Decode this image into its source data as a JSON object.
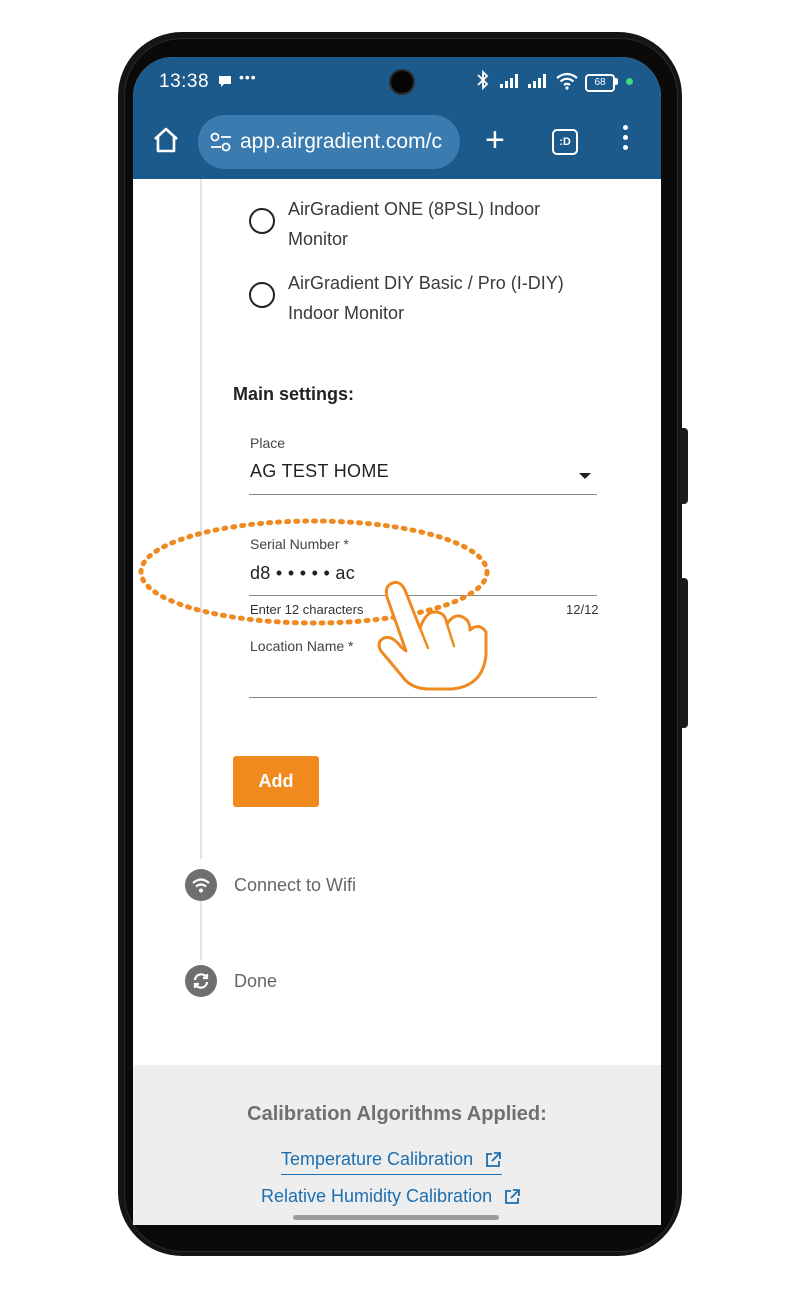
{
  "status_bar": {
    "time": "13:38",
    "extra": "•••",
    "battery": "68"
  },
  "browser": {
    "url": "app.airgradient.com/c"
  },
  "models": [
    {
      "line1": "AirGradient ONE (8PSL) Indoor",
      "line2": "Monitor"
    },
    {
      "line1": "AirGradient DIY Basic / Pro (I-DIY)",
      "line2": "Indoor Monitor"
    }
  ],
  "main_settings": {
    "title": "Main settings:",
    "place_label": "Place",
    "place_value": "AG TEST HOME",
    "serial_label": "Serial Number *",
    "serial_value": "d8 • • • • • ac",
    "serial_helper": "Enter 12 characters",
    "serial_count": "12/12",
    "location_label": "Location Name *",
    "location_value": "",
    "add_button": "Add"
  },
  "steps": [
    {
      "label": "Connect to Wifi",
      "icon": "wifi-icon"
    },
    {
      "label": "Done",
      "icon": "sync-icon"
    }
  ],
  "footer": {
    "title": "Calibration Algorithms Applied:",
    "link1": "Temperature Calibration",
    "link2": "Relative Humidity Calibration"
  },
  "colors": {
    "browser_bar": "#1d5a8c",
    "accent": "#f08a1c",
    "link": "#1d6fb0"
  }
}
